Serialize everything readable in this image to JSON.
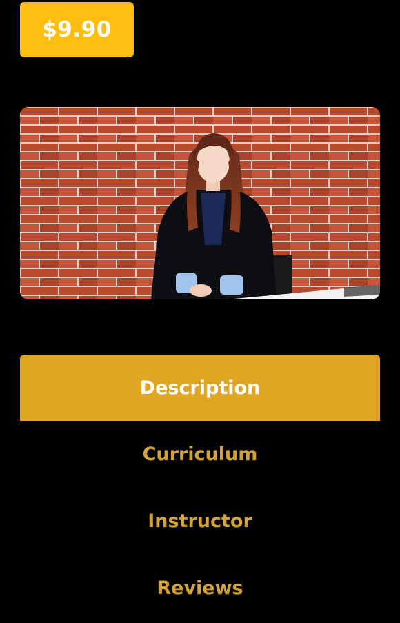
{
  "price": {
    "label": "$9.90"
  },
  "video": {
    "alt": "Course preview video thumbnail"
  },
  "tabs": [
    {
      "label": "Description",
      "active": true
    },
    {
      "label": "Curriculum",
      "active": false
    },
    {
      "label": "Instructor",
      "active": false
    },
    {
      "label": "Reviews",
      "active": false
    }
  ],
  "colors": {
    "accent": "#FDBE0F",
    "tab_active_bg": "#E0A623",
    "tab_inactive_text": "#D4A43A",
    "background": "#000000"
  }
}
